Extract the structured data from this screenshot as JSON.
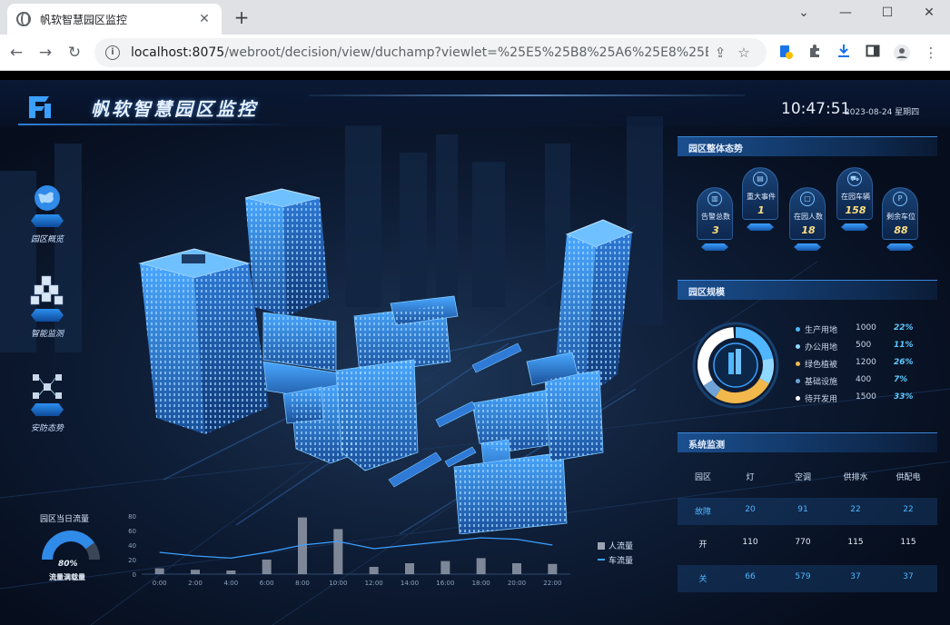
{
  "browser": {
    "tab_title": "帆软智慧园区监控",
    "tab_close": "✕",
    "new_tab": "+",
    "url_host": "localhost:8075",
    "url_rest": "/webroot/decision/view/duchamp?viewlet=%25E5%25B8%25A6%25E8%25BD...",
    "window_controls": {
      "chevron": "⌄",
      "minimize": "—",
      "maximize": "☐",
      "close": "✕"
    }
  },
  "header": {
    "title": "帆软智慧园区监控",
    "time": "10:47:51",
    "date": "2023-08-24 星期四"
  },
  "left_nav": [
    {
      "label": "园区概览",
      "icon": "globe-icon"
    },
    {
      "label": "智能监测",
      "icon": "cubes-icon"
    },
    {
      "label": "安防态势",
      "icon": "network-icon"
    }
  ],
  "overview": {
    "title": "园区整体态势",
    "kpis": [
      {
        "label": "告警总数",
        "value": "3",
        "icon": "building-icon"
      },
      {
        "label": "重大事件",
        "value": "1",
        "icon": "document-icon"
      },
      {
        "label": "在园人数",
        "value": "18",
        "icon": "person-icon"
      },
      {
        "label": "在园车辆",
        "value": "158",
        "icon": "truck-icon"
      },
      {
        "label": "剩余车位",
        "value": "88",
        "icon": "parking-icon"
      }
    ]
  },
  "scale": {
    "title": "园区规模",
    "items": [
      {
        "name": "生产用地",
        "value": "1000",
        "pct": "22%",
        "color": "#4fb6ff"
      },
      {
        "name": "办公用地",
        "value": "500",
        "pct": "11%",
        "color": "#8fd8ff"
      },
      {
        "name": "绿色植被",
        "value": "1200",
        "pct": "26%",
        "color": "#f2b84b"
      },
      {
        "name": "基础设施",
        "value": "400",
        "pct": "7%",
        "color": "#6fa3d6"
      },
      {
        "name": "待开发用",
        "value": "1500",
        "pct": "33%",
        "color": "#ffffff"
      }
    ],
    "donut": [
      {
        "share": 0.22,
        "color": "#4fb6ff"
      },
      {
        "share": 0.11,
        "color": "#8fd8ff"
      },
      {
        "share": 0.26,
        "color": "#f2b84b"
      },
      {
        "share": 0.07,
        "color": "#6fa3d6"
      },
      {
        "share": 0.33,
        "color": "#ffffff"
      }
    ]
  },
  "system": {
    "title": "系统监测",
    "columns": [
      "园区",
      "灯",
      "空调",
      "供排水",
      "供配电"
    ],
    "rows": [
      [
        "故障",
        "20",
        "91",
        "22",
        "22"
      ],
      [
        "开",
        "110",
        "770",
        "115",
        "115"
      ],
      [
        "关",
        "66",
        "579",
        "37",
        "37"
      ]
    ]
  },
  "flow": {
    "title": "园区当日流量",
    "gauge_pct": "80%",
    "gauge_value": 0.8,
    "gauge_label": "流量满载量",
    "legend": [
      "人流量",
      "车流量"
    ]
  },
  "chart_data": {
    "type": "bar",
    "categories": [
      "0:00",
      "2:00",
      "4:00",
      "6:00",
      "8:00",
      "10:00",
      "12:00",
      "14:00",
      "16:00",
      "18:00",
      "20:00",
      "22:00"
    ],
    "series": [
      {
        "name": "人流量",
        "values": [
          8,
          6,
          5,
          20,
          78,
          62,
          10,
          15,
          18,
          22,
          15,
          14
        ]
      },
      {
        "name": "车流量",
        "values": [
          30,
          25,
          22,
          30,
          40,
          45,
          35,
          40,
          45,
          50,
          48,
          40
        ]
      }
    ],
    "yticks": [
      "0",
      "20",
      "40",
      "60",
      "80"
    ],
    "ylim": [
      0,
      80
    ],
    "colors": {
      "bar": "#9aa3b1",
      "line": "#3aa0ff"
    },
    "legend_placement": "right"
  }
}
